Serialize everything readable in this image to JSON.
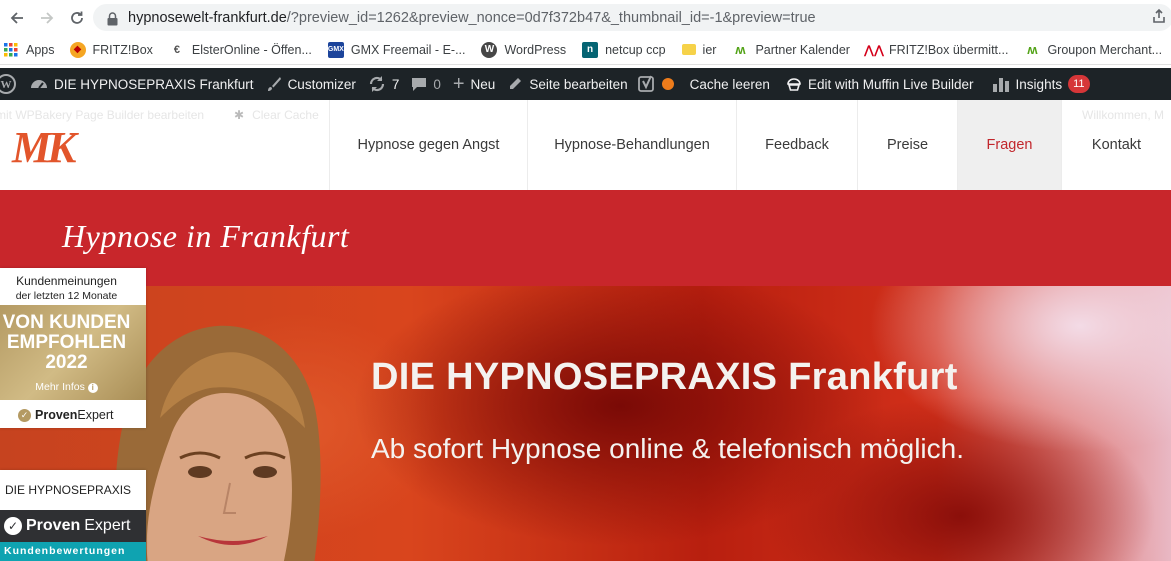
{
  "browser": {
    "url_host": "hypnosewelt-frankfurt.de",
    "url_rest": "/?preview_id=1262&preview_nonce=0d7f372b47&_thumbnail_id=-1&preview=true",
    "nav": {
      "back_icon": "arrow-left-icon",
      "forward_icon": "arrow-right-icon",
      "reload_icon": "reload-icon"
    }
  },
  "bookmarks": [
    {
      "label": "Apps",
      "icon": "apps-grid-icon"
    },
    {
      "label": "FRITZ!Box",
      "icon": "fritzbox-icon"
    },
    {
      "label": "ElsterOnline - Öffen...",
      "icon": "elster-icon"
    },
    {
      "label": "GMX Freemail - E-...",
      "icon": "gmx-icon"
    },
    {
      "label": "WordPress",
      "icon": "wordpress-icon"
    },
    {
      "label": "netcup ccp",
      "icon": "netcup-icon"
    },
    {
      "label": "ier",
      "icon": "folder-icon"
    },
    {
      "label": "Partner Kalender",
      "icon": "partner-icon"
    },
    {
      "label": "FRITZ!Box übermitt...",
      "icon": "avm-icon"
    },
    {
      "label": "Groupon Merchant...",
      "icon": "groupon-icon"
    }
  ],
  "adminbar": {
    "site_name": "DIE HYPNOSEPRAXIS Frankfurt",
    "customizer": "Customizer",
    "updates_count": "7",
    "comments_count": "0",
    "new": "Neu",
    "edit_page": "Seite bearbeiten",
    "cache": "Cache leeren",
    "muffin": "Edit with Muffin Live Builder",
    "insights": "Insights",
    "insights_badge": "11"
  },
  "ghost": {
    "wpbakery": "mit WPBakery Page Builder bearbeiten",
    "clear_cache": "Clear Cache",
    "welcome": "Willkommen, M"
  },
  "header": {
    "logo": "MK",
    "menu": [
      {
        "label": "Hypnose gegen Angst",
        "active": false
      },
      {
        "label": "Hypnose-Behandlungen",
        "active": false
      },
      {
        "label": "Feedback",
        "active": false
      },
      {
        "label": "Preise",
        "active": false
      },
      {
        "label": "Fragen",
        "active": true
      },
      {
        "label": "Kontakt",
        "active": false
      }
    ]
  },
  "page": {
    "title": "Hypnose in Frankfurt"
  },
  "hero": {
    "headline": "DIE HYPNOSEPRAXIS Frankfurt",
    "subline": "Ab sofort Hypnose online & telefonisch möglich."
  },
  "proven_badge": {
    "line1": "Kundenmeinungen",
    "line2": "der letzten 12 Monate",
    "big1": "VON KUNDEN",
    "big2": "EMPFOHLEN",
    "big3": "2022",
    "more": "Mehr Infos",
    "brand_bold": "Proven",
    "brand_rest": "Expert"
  },
  "proven_card": {
    "name": "DIE HYPNOSEPRAXIS",
    "brand_bold": "Proven",
    "brand_rest": "Expert",
    "sub": "Kundenbewertungen"
  },
  "colors": {
    "brand_red": "#c8262b",
    "logo_orange": "#e2552b",
    "adminbar": "#1d2327",
    "badge_gold": "#c3ab72",
    "teal": "#0fa3b1"
  }
}
